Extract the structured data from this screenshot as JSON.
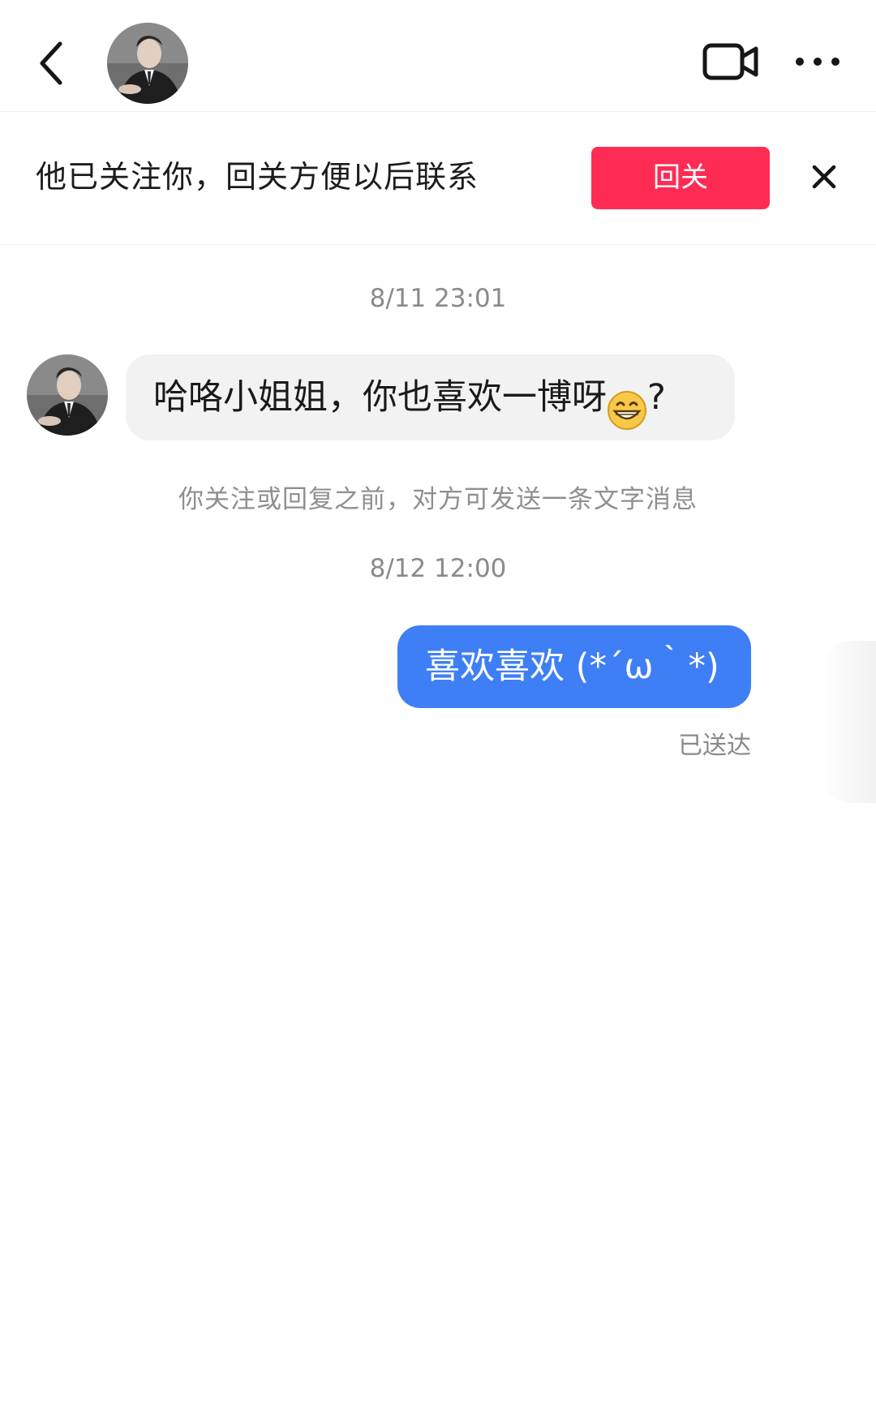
{
  "header": {
    "back": "back-icon",
    "video_call": "video-camera-icon",
    "more": "more-icon"
  },
  "follow_banner": {
    "text": "他已关注你，回关方便以后联系",
    "button_label": "回关",
    "button_color": "#fe2c55",
    "close": "close-icon"
  },
  "messages": {
    "timestamp_1": "8/11 23:01",
    "incoming_text": "哈咯小姐姐，你也喜欢一博呀",
    "incoming_suffix": "?",
    "incoming_emoji": "grinning-emoji",
    "notice": "你关注或回复之前，对方可发送一条文字消息",
    "timestamp_2": "8/12 12:00",
    "outgoing_text": "喜欢喜欢 (*´ω｀*)",
    "outgoing_color": "#3f7ff5",
    "delivered": "已送达"
  }
}
